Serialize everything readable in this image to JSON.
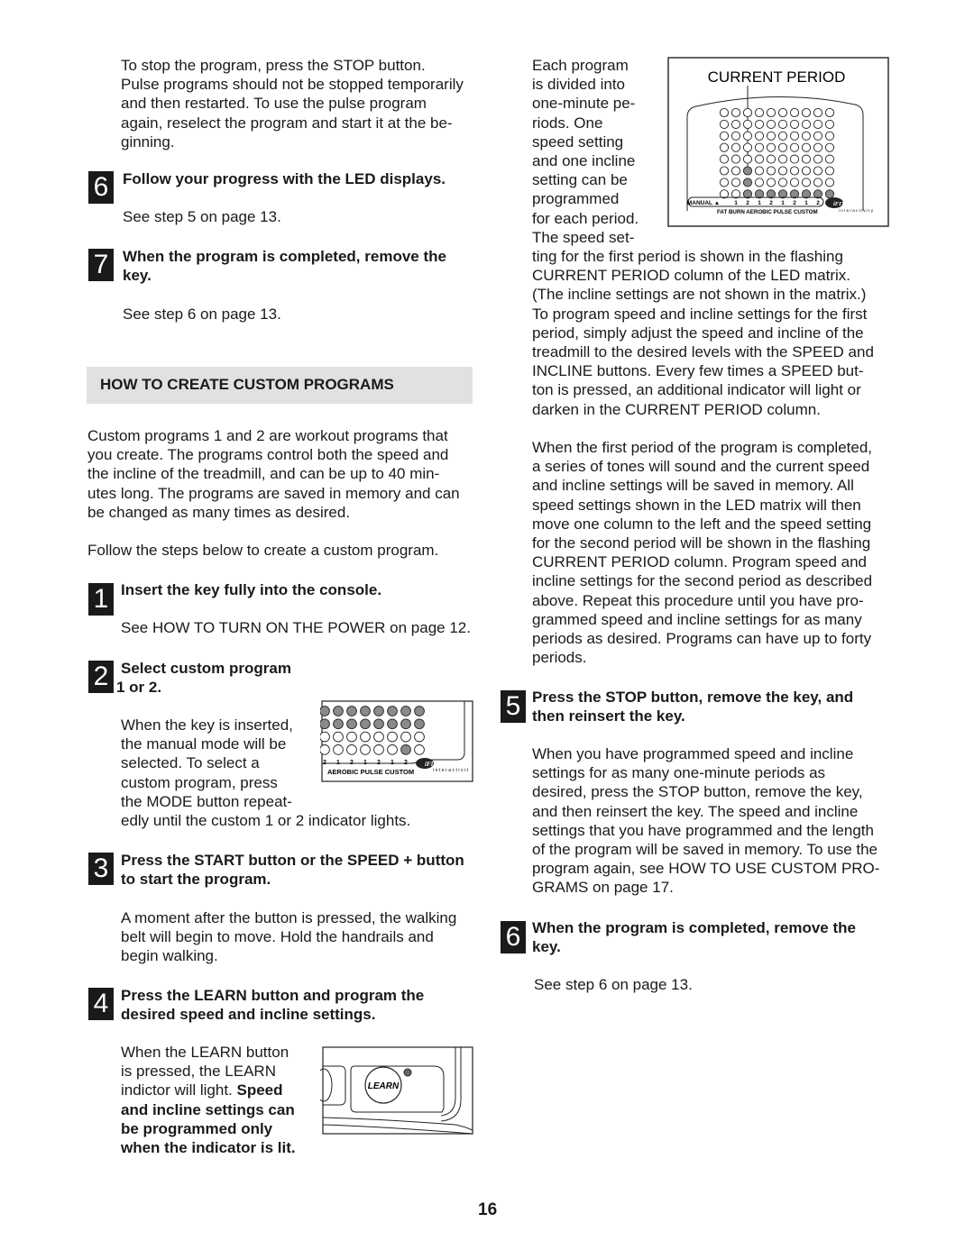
{
  "left": {
    "intro": [
      "To stop the program, press the STOP button.",
      "Pulse programs should not be stopped temporarily",
      "and then restarted. To use the pulse program",
      "again, reselect the program and start it at the be-",
      "ginning."
    ],
    "step6": {
      "number": "6",
      "heading": [
        "Follow your progress with the LED displays."
      ],
      "body": "See step 5 on page 13."
    },
    "step7": {
      "number": "7",
      "heading": [
        "When the program is completed, remove the",
        "key."
      ],
      "body": "See step 6 on page 13."
    },
    "section_title": "HOW TO CREATE CUSTOM PROGRAMS",
    "section_intro": [
      "Custom programs 1 and 2 are workout programs that",
      "you create. The programs control both the speed and",
      "the incline of the treadmill, and can be up to 40 min-",
      "utes long. The programs are saved in memory and can",
      "be changed as many times as desired."
    ],
    "section_follow": "Follow the steps below to create a custom program.",
    "s1": {
      "number": "1",
      "heading": [
        "Insert the key fully into the console."
      ],
      "body": "See HOW TO TURN ON THE POWER on page 12."
    },
    "s2": {
      "number": "2",
      "heading": [
        "Select custom program",
        "1 or 2."
      ],
      "body": [
        "When the key is inserted,",
        "the manual mode will be",
        "selected. To select a",
        "custom program, press",
        "the MODE button repeat-",
        "edly until the custom 1 or 2 indicator lights."
      ]
    },
    "s3": {
      "number": "3",
      "heading": [
        "Press the START button or the SPEED + button",
        "to start the program."
      ],
      "body": [
        "A moment after the button is pressed, the walking",
        "belt will begin to move. Hold the handrails and",
        "begin walking."
      ]
    },
    "s4": {
      "number": "4",
      "heading": [
        "Press the LEARN button and program the",
        "desired speed and incline settings."
      ],
      "body_line1": "When the LEARN button",
      "body_line2": "is pressed, the LEARN",
      "body_line3_plain": "indictor will light. ",
      "body_line3_bold": "Speed",
      "body_bold": [
        "and incline settings can",
        "be programmed only",
        "when the indicator is lit."
      ]
    }
  },
  "right": {
    "para1": [
      "Each program",
      "is divided into",
      "one-minute pe-",
      "riods. One",
      "speed setting",
      "and one incline",
      "setting can be",
      "programmed",
      "for each period.",
      "The speed set-",
      "ting for the first period is shown in the flashing",
      "CURRENT PERIOD column of the LED matrix.",
      "(The incline settings are not shown in the matrix.)",
      "To program speed and incline settings for the first",
      "period, simply adjust the speed and incline of the",
      "treadmill to the desired levels with the SPEED and",
      "INCLINE buttons. Every few times a SPEED but-",
      "ton is pressed, an additional indicator will light or",
      "darken in the CURRENT PERIOD column."
    ],
    "para2": [
      "When the first period of the program is completed,",
      "a series of tones will sound and the current speed",
      "and incline settings will be saved in memory. All",
      "speed settings shown in the LED matrix will then",
      "move one column to the left and the speed setting",
      "for the second period will be shown in the flashing",
      "CURRENT PERIOD column. Program speed and",
      "incline settings for the second period as described",
      "above. Repeat this procedure until you have pro-",
      "grammed speed and incline settings for as many",
      "periods as desired. Programs can have up to forty",
      "periods."
    ],
    "s5": {
      "number": "5",
      "heading": [
        "Press the STOP button, remove the key, and",
        "then reinsert the key."
      ],
      "body": [
        "When you have programmed speed and incline",
        "settings for as many one-minute periods as",
        "desired, press the STOP button, remove the key,",
        "and then reinsert the key. The speed and incline",
        "settings that you have programmed and the length",
        "of the program will be saved in memory. To use the",
        "program again, see HOW TO USE CUSTOM PRO-",
        "GRAMS on page 17."
      ]
    },
    "s6": {
      "number": "6",
      "heading": [
        "When the program is completed, remove the",
        "key."
      ],
      "body": "See step 6 on page 13."
    }
  },
  "figure_matrix": {
    "title": "CURRENT PERIOD",
    "lit": [
      "0000000000",
      "0000000000",
      "0000000000",
      "0000000000",
      "0000000000",
      "0010000000",
      "0010000000",
      "0011111111"
    ],
    "labels": [
      "MANUAL ▲",
      "1",
      "2",
      "1",
      "2",
      "1",
      "2",
      "1",
      "2"
    ],
    "programs": "FAT BURN AEROBIC PULSE CUSTOM",
    "logo": "iFIT.com",
    "logo_sub": "interactivity"
  },
  "figure_custom": {
    "lit": [
      "11111111",
      "11111111",
      "00000000",
      "00000010"
    ],
    "labels": [
      "2",
      "1",
      "2",
      "1",
      "2",
      "1",
      "2"
    ],
    "programs": "AEROBIC PULSE CUSTOM",
    "logo": "iFIT.com",
    "logo_sub": "interactivit"
  },
  "figure_learn": {
    "button": "LEARN"
  },
  "page_number": "16",
  "colors": {
    "badge": "#1a1a1a",
    "band": "#e1e1e1",
    "led_lit": "#8a8a8a"
  }
}
